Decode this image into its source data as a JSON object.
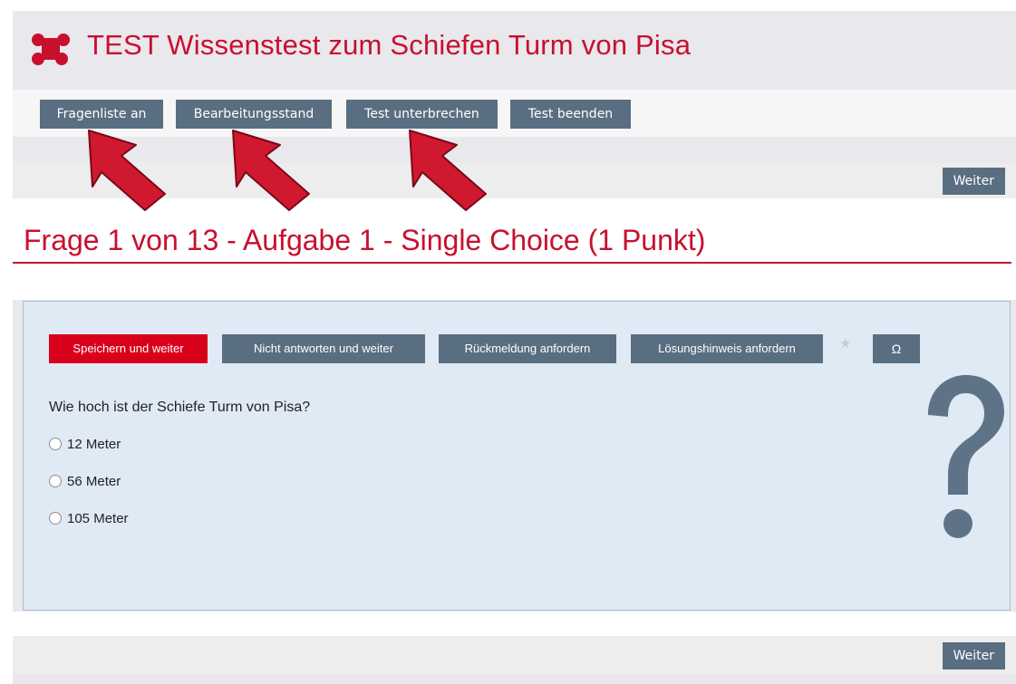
{
  "app": {
    "title": "TEST Wissenstest zum Schiefen Turm von Pisa",
    "accent": "#c8102e",
    "button_color": "#5a6e82"
  },
  "toolbar": {
    "buttons": [
      {
        "label": "Fragenliste an"
      },
      {
        "label": "Bearbeitungsstand"
      },
      {
        "label": "Test unterbrechen"
      },
      {
        "label": "Test beenden"
      }
    ]
  },
  "nav": {
    "next_top": "Weiter",
    "next_bottom": "Weiter"
  },
  "question": {
    "heading": "Frage 1 von 13 - Aufgabe 1 - Single Choice (1 Punkt)",
    "text": "Wie hoch ist der Schiefe Turm von Pisa?",
    "options": [
      {
        "label": "12 Meter",
        "selected": false
      },
      {
        "label": "56 Meter",
        "selected": false
      },
      {
        "label": "105 Meter",
        "selected": false
      }
    ]
  },
  "actions": {
    "save_next": "Speichern und weiter",
    "skip_next": "Nicht antworten und weiter",
    "feedback": "Rückmeldung anfordern",
    "hint": "Lösungshinweis anfordern",
    "omega": "Ω",
    "star_icon": "star-icon"
  },
  "icons": {
    "logo": "puzzle-icon",
    "question_mark": "question-mark-icon",
    "annotation_arrows": "arrow-icon"
  }
}
